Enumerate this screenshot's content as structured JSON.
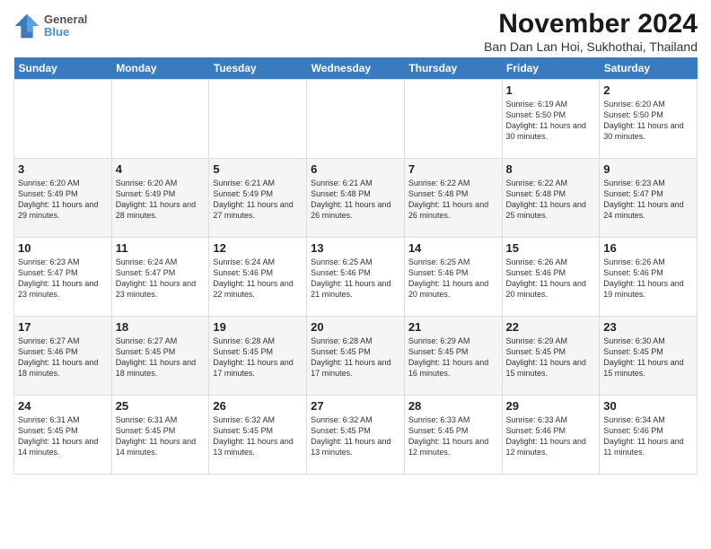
{
  "logo": {
    "line1": "General",
    "line2": "Blue"
  },
  "title": "November 2024",
  "subtitle": "Ban Dan Lan Hoi, Sukhothai, Thailand",
  "headers": [
    "Sunday",
    "Monday",
    "Tuesday",
    "Wednesday",
    "Thursday",
    "Friday",
    "Saturday"
  ],
  "weeks": [
    [
      {
        "day": "",
        "info": ""
      },
      {
        "day": "",
        "info": ""
      },
      {
        "day": "",
        "info": ""
      },
      {
        "day": "",
        "info": ""
      },
      {
        "day": "",
        "info": ""
      },
      {
        "day": "1",
        "info": "Sunrise: 6:19 AM\nSunset: 5:50 PM\nDaylight: 11 hours and 30 minutes."
      },
      {
        "day": "2",
        "info": "Sunrise: 6:20 AM\nSunset: 5:50 PM\nDaylight: 11 hours and 30 minutes."
      }
    ],
    [
      {
        "day": "3",
        "info": "Sunrise: 6:20 AM\nSunset: 5:49 PM\nDaylight: 11 hours and 29 minutes."
      },
      {
        "day": "4",
        "info": "Sunrise: 6:20 AM\nSunset: 5:49 PM\nDaylight: 11 hours and 28 minutes."
      },
      {
        "day": "5",
        "info": "Sunrise: 6:21 AM\nSunset: 5:49 PM\nDaylight: 11 hours and 27 minutes."
      },
      {
        "day": "6",
        "info": "Sunrise: 6:21 AM\nSunset: 5:48 PM\nDaylight: 11 hours and 26 minutes."
      },
      {
        "day": "7",
        "info": "Sunrise: 6:22 AM\nSunset: 5:48 PM\nDaylight: 11 hours and 26 minutes."
      },
      {
        "day": "8",
        "info": "Sunrise: 6:22 AM\nSunset: 5:48 PM\nDaylight: 11 hours and 25 minutes."
      },
      {
        "day": "9",
        "info": "Sunrise: 6:23 AM\nSunset: 5:47 PM\nDaylight: 11 hours and 24 minutes."
      }
    ],
    [
      {
        "day": "10",
        "info": "Sunrise: 6:23 AM\nSunset: 5:47 PM\nDaylight: 11 hours and 23 minutes."
      },
      {
        "day": "11",
        "info": "Sunrise: 6:24 AM\nSunset: 5:47 PM\nDaylight: 11 hours and 23 minutes."
      },
      {
        "day": "12",
        "info": "Sunrise: 6:24 AM\nSunset: 5:46 PM\nDaylight: 11 hours and 22 minutes."
      },
      {
        "day": "13",
        "info": "Sunrise: 6:25 AM\nSunset: 5:46 PM\nDaylight: 11 hours and 21 minutes."
      },
      {
        "day": "14",
        "info": "Sunrise: 6:25 AM\nSunset: 5:46 PM\nDaylight: 11 hours and 20 minutes."
      },
      {
        "day": "15",
        "info": "Sunrise: 6:26 AM\nSunset: 5:46 PM\nDaylight: 11 hours and 20 minutes."
      },
      {
        "day": "16",
        "info": "Sunrise: 6:26 AM\nSunset: 5:46 PM\nDaylight: 11 hours and 19 minutes."
      }
    ],
    [
      {
        "day": "17",
        "info": "Sunrise: 6:27 AM\nSunset: 5:46 PM\nDaylight: 11 hours and 18 minutes."
      },
      {
        "day": "18",
        "info": "Sunrise: 6:27 AM\nSunset: 5:45 PM\nDaylight: 11 hours and 18 minutes."
      },
      {
        "day": "19",
        "info": "Sunrise: 6:28 AM\nSunset: 5:45 PM\nDaylight: 11 hours and 17 minutes."
      },
      {
        "day": "20",
        "info": "Sunrise: 6:28 AM\nSunset: 5:45 PM\nDaylight: 11 hours and 17 minutes."
      },
      {
        "day": "21",
        "info": "Sunrise: 6:29 AM\nSunset: 5:45 PM\nDaylight: 11 hours and 16 minutes."
      },
      {
        "day": "22",
        "info": "Sunrise: 6:29 AM\nSunset: 5:45 PM\nDaylight: 11 hours and 15 minutes."
      },
      {
        "day": "23",
        "info": "Sunrise: 6:30 AM\nSunset: 5:45 PM\nDaylight: 11 hours and 15 minutes."
      }
    ],
    [
      {
        "day": "24",
        "info": "Sunrise: 6:31 AM\nSunset: 5:45 PM\nDaylight: 11 hours and 14 minutes."
      },
      {
        "day": "25",
        "info": "Sunrise: 6:31 AM\nSunset: 5:45 PM\nDaylight: 11 hours and 14 minutes."
      },
      {
        "day": "26",
        "info": "Sunrise: 6:32 AM\nSunset: 5:45 PM\nDaylight: 11 hours and 13 minutes."
      },
      {
        "day": "27",
        "info": "Sunrise: 6:32 AM\nSunset: 5:45 PM\nDaylight: 11 hours and 13 minutes."
      },
      {
        "day": "28",
        "info": "Sunrise: 6:33 AM\nSunset: 5:45 PM\nDaylight: 11 hours and 12 minutes."
      },
      {
        "day": "29",
        "info": "Sunrise: 6:33 AM\nSunset: 5:46 PM\nDaylight: 11 hours and 12 minutes."
      },
      {
        "day": "30",
        "info": "Sunrise: 6:34 AM\nSunset: 5:46 PM\nDaylight: 11 hours and 11 minutes."
      }
    ]
  ]
}
